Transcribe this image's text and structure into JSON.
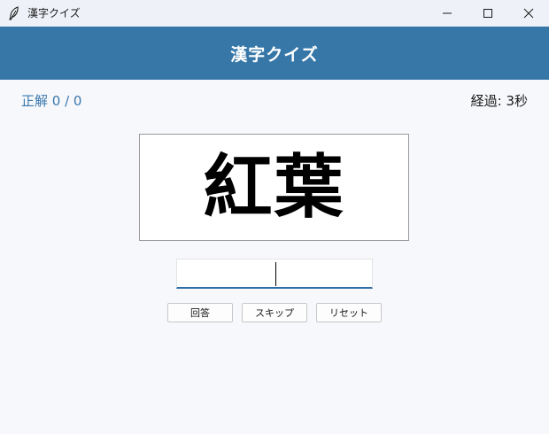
{
  "window": {
    "title": "漢字クイズ",
    "icon": "feather-icon",
    "controls": [
      "minimize-icon",
      "maximize-icon",
      "close-icon"
    ]
  },
  "header": {
    "title": "漢字クイズ",
    "background": "#3677a8"
  },
  "status": {
    "score": "正解 0 / 0",
    "elapsed": "経過: 3秒"
  },
  "question": {
    "kanji": "紅葉"
  },
  "answer": {
    "value": "",
    "placeholder": ""
  },
  "buttons": {
    "answer_label": "回答",
    "skip_label": "スキップ",
    "reset_label": "リセット"
  },
  "colors": {
    "accent": "#3677a8",
    "score_text": "#3a78ad",
    "input_underline": "#2f6fa6"
  }
}
